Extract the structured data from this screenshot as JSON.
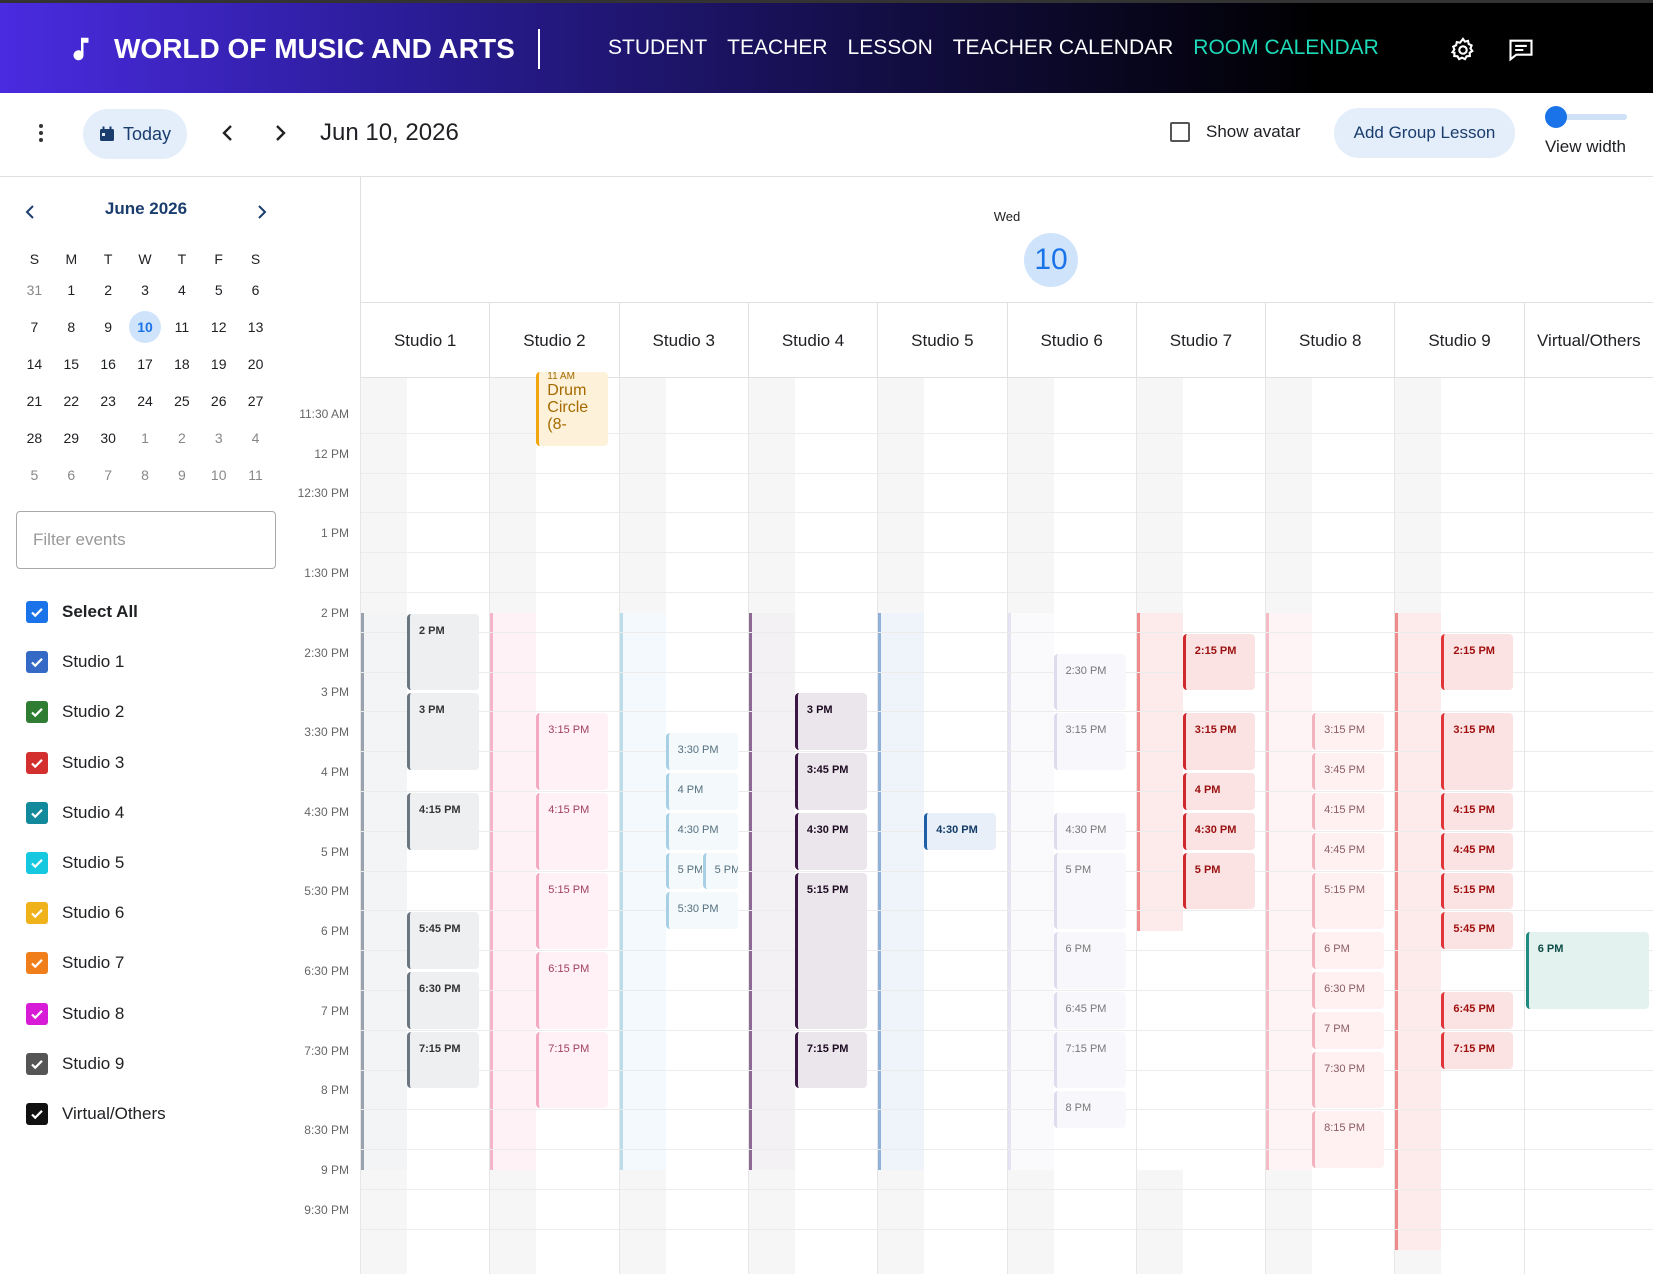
{
  "app": {
    "title": "WORLD OF MUSIC AND ARTS",
    "nav": [
      "STUDENT",
      "TEACHER",
      "LESSON",
      "TEACHER CALENDAR",
      "ROOM CALENDAR"
    ],
    "active_nav": "ROOM CALENDAR",
    "icons": [
      "music-note-icon",
      "settings-gear-icon",
      "feedback-chat-icon"
    ]
  },
  "toolbar": {
    "today_label": "Today",
    "date": "Jun 10, 2026",
    "show_avatar_label": "Show avatar",
    "show_avatar_checked": false,
    "add_group_label": "Add Group Lesson",
    "view_width_label": "View width",
    "view_width_value": 0.0
  },
  "mini_calendar": {
    "title": "June 2026",
    "weekdays": [
      "S",
      "M",
      "T",
      "W",
      "T",
      "F",
      "S"
    ],
    "days": [
      "31",
      "1",
      "2",
      "3",
      "4",
      "5",
      "6",
      "7",
      "8",
      "9",
      "10",
      "11",
      "12",
      "13",
      "14",
      "15",
      "16",
      "17",
      "18",
      "19",
      "20",
      "21",
      "22",
      "23",
      "24",
      "25",
      "26",
      "27",
      "28",
      "29",
      "30",
      "1",
      "2",
      "3",
      "4",
      "5",
      "6",
      "7",
      "8",
      "9",
      "10",
      "11"
    ],
    "dim_days_index": [
      0,
      31,
      32,
      33,
      34,
      35,
      36,
      37,
      38,
      39,
      40,
      41
    ],
    "selected_index": 10
  },
  "filter": {
    "placeholder": "Filter events",
    "items": [
      {
        "label": "Select All",
        "color": "#1a73e8",
        "bold": true
      },
      {
        "label": "Studio 1",
        "color": "#3569c6"
      },
      {
        "label": "Studio 2",
        "color": "#2e7d32"
      },
      {
        "label": "Studio 3",
        "color": "#d32f2f"
      },
      {
        "label": "Studio 4",
        "color": "#13899c"
      },
      {
        "label": "Studio 5",
        "color": "#15c8e0"
      },
      {
        "label": "Studio 6",
        "color": "#f0b21b"
      },
      {
        "label": "Studio 7",
        "color": "#f07f1b"
      },
      {
        "label": "Studio 8",
        "color": "#d81bd6"
      },
      {
        "label": "Studio 9",
        "color": "#555555"
      },
      {
        "label": "Virtual/Others",
        "color": "#111111"
      }
    ]
  },
  "day": {
    "dow": "Wed",
    "num": "10"
  },
  "rooms": [
    "Studio 1",
    "Studio 2",
    "Studio 3",
    "Studio 4",
    "Studio 5",
    "Studio 6",
    "Studio 7",
    "Studio 8",
    "Studio 9",
    "Virtual/Others"
  ],
  "time_labels": [
    "11:30 AM",
    "12 PM",
    "12:30 PM",
    "1 PM",
    "1:30 PM",
    "2 PM",
    "2:30 PM",
    "3 PM",
    "3:30 PM",
    "4 PM",
    "4:30 PM",
    "5 PM",
    "5:30 PM",
    "6 PM",
    "6:30 PM",
    "7 PM",
    "7:30 PM",
    "8 PM",
    "8:30 PM",
    "9 PM",
    "9:30 PM"
  ],
  "room_styles": [
    {
      "bar": "#9aa3ad",
      "shade": "#f3f4f6",
      "ev_bg": "#eeeff1",
      "ev_border": "#6c7680",
      "text": "#333"
    },
    {
      "bar": "#f5b5c9",
      "shade": "#fff2f6",
      "ev_bg": "#fff1f5",
      "ev_border": "#f3a9c0",
      "text": "#a04060"
    },
    {
      "bar": "#bcdcec",
      "shade": "#f3f9fc",
      "ev_bg": "#f4f9fc",
      "ev_border": "#a7d0e6",
      "text": "#55707f"
    },
    {
      "bar": "#8c6a93",
      "shade": "#f3f1f4",
      "ev_bg": "#ebe6ec",
      "ev_border": "#3a1843",
      "text": "#1c0b21"
    },
    {
      "bar": "#8fb0d8",
      "shade": "#eff4fb",
      "ev_bg": "#e8eff8",
      "ev_border": "#1e5fa8",
      "text": "#123a66"
    },
    {
      "bar": "#e3e3f1",
      "shade": "#fafafc",
      "ev_bg": "#f8f8fc",
      "ev_border": "#dcdcee",
      "text": "#777"
    },
    {
      "bar": "#f08a8a",
      "shade": "#fdeaea",
      "ev_bg": "#fbe3e3",
      "ev_border": "#d0282e",
      "text": "#9a1010"
    },
    {
      "bar": "#f6bcc6",
      "shade": "#fff4f5",
      "ev_bg": "#fff1f2",
      "ev_border": "#f3b3be",
      "text": "#8a5b63"
    },
    {
      "bar": "#f08a8a",
      "shade": "#fdeaea",
      "ev_bg": "#fbe3e3",
      "ev_border": "#e0363a",
      "text": "#a01010"
    },
    {
      "bar": "#ffffff",
      "shade": "#ffffff",
      "ev_bg": "#e3f1ef",
      "ev_border": "#1e8a80",
      "text": "#0d4d47"
    }
  ],
  "drum_event": {
    "room": 1,
    "lines": [
      "11 AM",
      "Drum",
      "Circle",
      "(8-"
    ]
  },
  "events": [
    {
      "room": 0,
      "label": "2 PM",
      "start": 14.0,
      "end": 15.0
    },
    {
      "room": 0,
      "label": "3 PM",
      "start": 15.0,
      "end": 16.0
    },
    {
      "room": 0,
      "label": "4:15 PM",
      "start": 16.25,
      "end": 17.0
    },
    {
      "room": 0,
      "label": "5:45 PM",
      "start": 17.75,
      "end": 18.5
    },
    {
      "room": 0,
      "label": "6:30 PM",
      "start": 18.5,
      "end": 19.25
    },
    {
      "room": 0,
      "label": "7:15 PM",
      "start": 19.25,
      "end": 20.0
    },
    {
      "room": 1,
      "label": "3:15 PM",
      "start": 15.25,
      "end": 16.25
    },
    {
      "room": 1,
      "label": "4:15 PM",
      "start": 16.25,
      "end": 17.25
    },
    {
      "room": 1,
      "label": "5:15 PM",
      "start": 17.25,
      "end": 18.25
    },
    {
      "room": 1,
      "label": "6:15 PM",
      "start": 18.25,
      "end": 19.25
    },
    {
      "room": 1,
      "label": "7:15 PM",
      "start": 19.25,
      "end": 20.25
    },
    {
      "room": 2,
      "label": "3:30 PM",
      "start": 15.5,
      "end": 16.0
    },
    {
      "room": 2,
      "label": "4 PM",
      "start": 16.0,
      "end": 16.5
    },
    {
      "room": 2,
      "label": "4:30 PM",
      "start": 16.5,
      "end": 17.0
    },
    {
      "room": 2,
      "label": "5 PM",
      "start": 17.0,
      "end": 17.5,
      "half": 0
    },
    {
      "room": 2,
      "label": "5 PM",
      "start": 17.0,
      "end": 17.5,
      "half": 1
    },
    {
      "room": 2,
      "label": "5:30 PM",
      "start": 17.5,
      "end": 18.0
    },
    {
      "room": 3,
      "label": "3 PM",
      "start": 15.0,
      "end": 15.75
    },
    {
      "room": 3,
      "label": "3:45 PM",
      "start": 15.75,
      "end": 16.5
    },
    {
      "room": 3,
      "label": "4:30 PM",
      "start": 16.5,
      "end": 17.25
    },
    {
      "room": 3,
      "label": "5:15 PM",
      "start": 17.25,
      "end": 19.25
    },
    {
      "room": 3,
      "label": "7:15 PM",
      "start": 19.25,
      "end": 20.0
    },
    {
      "room": 4,
      "label": "4:30 PM",
      "start": 16.5,
      "end": 17.0
    },
    {
      "room": 5,
      "label": "2:30 PM",
      "start": 14.5,
      "end": 15.25
    },
    {
      "room": 5,
      "label": "3:15 PM",
      "start": 15.25,
      "end": 16.0
    },
    {
      "room": 5,
      "label": "4:30 PM",
      "start": 16.5,
      "end": 17.0
    },
    {
      "room": 5,
      "label": "5 PM",
      "start": 17.0,
      "end": 18.0
    },
    {
      "room": 5,
      "label": "6 PM",
      "start": 18.0,
      "end": 18.75
    },
    {
      "room": 5,
      "label": "6:45 PM",
      "start": 18.75,
      "end": 19.25
    },
    {
      "room": 5,
      "label": "7:15 PM",
      "start": 19.25,
      "end": 20.0
    },
    {
      "room": 5,
      "label": "8 PM",
      "start": 20.0,
      "end": 20.5
    },
    {
      "room": 6,
      "label": "2:15 PM",
      "start": 14.25,
      "end": 15.0
    },
    {
      "room": 6,
      "label": "3:15 PM",
      "start": 15.25,
      "end": 16.0
    },
    {
      "room": 6,
      "label": "4 PM",
      "start": 16.0,
      "end": 16.5
    },
    {
      "room": 6,
      "label": "4:30 PM",
      "start": 16.5,
      "end": 17.0
    },
    {
      "room": 6,
      "label": "5 PM",
      "start": 17.0,
      "end": 17.75
    },
    {
      "room": 7,
      "label": "3:15 PM",
      "start": 15.25,
      "end": 15.75
    },
    {
      "room": 7,
      "label": "3:45 PM",
      "start": 15.75,
      "end": 16.25
    },
    {
      "room": 7,
      "label": "4:15 PM",
      "start": 16.25,
      "end": 16.75
    },
    {
      "room": 7,
      "label": "4:45 PM",
      "start": 16.75,
      "end": 17.25
    },
    {
      "room": 7,
      "label": "5:15 PM",
      "start": 17.25,
      "end": 18.0
    },
    {
      "room": 7,
      "label": "6 PM",
      "start": 18.0,
      "end": 18.5
    },
    {
      "room": 7,
      "label": "6:30 PM",
      "start": 18.5,
      "end": 19.0
    },
    {
      "room": 7,
      "label": "7 PM",
      "start": 19.0,
      "end": 19.5
    },
    {
      "room": 7,
      "label": "7:30 PM",
      "start": 19.5,
      "end": 20.25
    },
    {
      "room": 7,
      "label": "8:15 PM",
      "start": 20.25,
      "end": 21.0
    },
    {
      "room": 8,
      "label": "2:15 PM",
      "start": 14.25,
      "end": 15.0
    },
    {
      "room": 8,
      "label": "3:15 PM",
      "start": 15.25,
      "end": 16.25
    },
    {
      "room": 8,
      "label": "4:15 PM",
      "start": 16.25,
      "end": 16.75
    },
    {
      "room": 8,
      "label": "4:45 PM",
      "start": 16.75,
      "end": 17.25
    },
    {
      "room": 8,
      "label": "5:15 PM",
      "start": 17.25,
      "end": 17.75
    },
    {
      "room": 8,
      "label": "5:45 PM",
      "start": 17.75,
      "end": 18.25
    },
    {
      "room": 8,
      "label": "6:45 PM",
      "start": 18.75,
      "end": 19.25
    },
    {
      "room": 8,
      "label": "7:15 PM",
      "start": 19.25,
      "end": 19.75
    },
    {
      "room": 9,
      "label": "6 PM",
      "start": 18.0,
      "end": 19.0
    }
  ],
  "room_bars": [
    {
      "room": 0,
      "start": 14.0,
      "end": 21.0
    },
    {
      "room": 1,
      "start": 14.0,
      "end": 21.0
    },
    {
      "room": 2,
      "start": 14.0,
      "end": 21.0
    },
    {
      "room": 3,
      "start": 14.0,
      "end": 21.0
    },
    {
      "room": 4,
      "start": 14.0,
      "end": 21.0
    },
    {
      "room": 5,
      "start": 14.0,
      "end": 21.0
    },
    {
      "room": 6,
      "start": 14.0,
      "end": 18.0
    },
    {
      "room": 7,
      "start": 14.0,
      "end": 21.0
    },
    {
      "room": 8,
      "start": 14.0,
      "end": 22.0
    }
  ]
}
